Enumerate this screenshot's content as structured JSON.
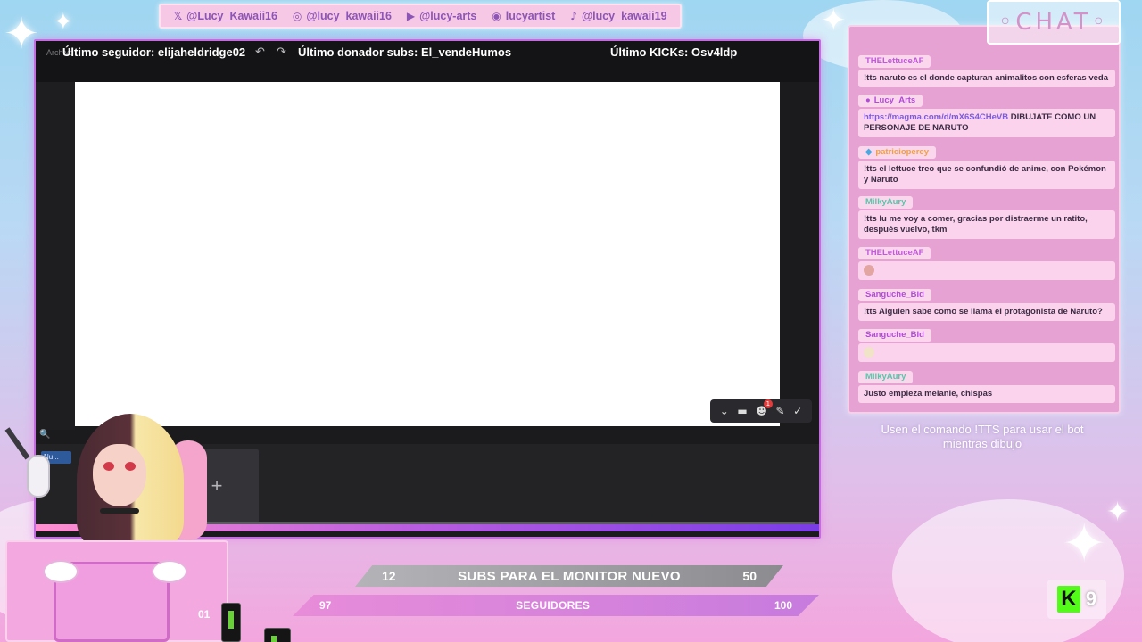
{
  "socials": [
    {
      "icon": "x-icon",
      "glyph": "𝕏",
      "label": "@Lucy_Kawaii16"
    },
    {
      "icon": "instagram-icon",
      "glyph": "◎",
      "label": "@lucy_kawaii16"
    },
    {
      "icon": "youtube-icon",
      "glyph": "▶",
      "label": "@lucy-arts"
    },
    {
      "icon": "discord-icon",
      "glyph": "◉",
      "label": "lucyartist"
    },
    {
      "icon": "tiktok-icon",
      "glyph": "♪",
      "label": "@lucy_kawaii19"
    }
  ],
  "ticker": {
    "follower": "Último seguidor: elijaheldridge02",
    "donor": "Último donador subs: El_vendeHumos",
    "kicks": "Último KICKs: Osv4ldp"
  },
  "app": {
    "menu_faint": "Archivo",
    "search_glyph": "🔍",
    "new_label": "Nu...",
    "add_layer": "+"
  },
  "chat": {
    "title": "◦CHAT◦",
    "messages": [
      {
        "user": "THELettuceAF",
        "color": "#c05adb",
        "text": "!tts naruto es el donde capturan animalitos con esferas veda"
      },
      {
        "user": "Lucy_Arts",
        "color": "#b04ad8",
        "link": "https://magma.com/d/mX6S4CHeVB",
        "text": " DIBUJATE COMO UN PERSONAJE DE NARUTO"
      },
      {
        "user": "patricioperey",
        "color": "#f0a040",
        "text": "!tts el lettuce treo que se confundió de anime, con Pokémon y Naruto"
      },
      {
        "user": "MilkyAury",
        "color": "#55c6a8",
        "text": "!tts lu me voy a comer, gracias por distraerme un ratito, después vuelvo, tkm"
      },
      {
        "user": "THELettuceAF",
        "color": "#c05adb",
        "text": ""
      },
      {
        "user": "Sanguche_Bld",
        "color": "#b04ad8",
        "text": "!tts Alguien sabe como se llama el protagonista de Naruto?"
      },
      {
        "user": "Sanguche_Bld",
        "color": "#b04ad8",
        "text": ""
      },
      {
        "user": "MilkyAury",
        "color": "#55c6a8",
        "text": "Justo empieza melanie, chispas"
      }
    ],
    "note": "Usen el comando !TTS para usar el bot mientras dibujo"
  },
  "goals": {
    "subs": {
      "current": "12",
      "label": "SUBS PARA EL MONITOR NUEVO",
      "target": "50"
    },
    "followers": {
      "current": "97",
      "label": "SEGUIDORES",
      "target": "100"
    }
  },
  "counter": "01",
  "kick_viewers": "9",
  "colors": {
    "accent": "#c46de0",
    "chat_bg": "#e5a2d3",
    "kick_green": "#53fc18"
  }
}
